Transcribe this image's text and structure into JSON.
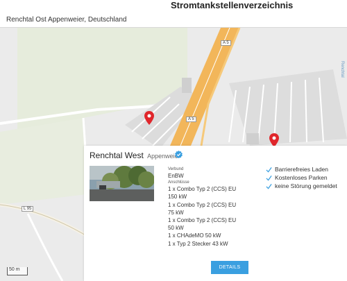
{
  "header": {
    "title": "Stromtankstellenverzeichnis",
    "location": "Renchtal Ost Appenweier, Deutschland"
  },
  "map": {
    "road_labels": [
      "A 5",
      "A 5",
      "L 95"
    ],
    "right_edge_text": "Renchtal",
    "scale": "50 m",
    "colors": {
      "background": "#ececec",
      "autobahn": "#f2b65a",
      "pin": "#e0262b"
    }
  },
  "card": {
    "name": "Renchtal West",
    "city": "Appenweier",
    "verified_icon": "verified-badge-icon",
    "operator_label": "Verbund",
    "operator": "EnBW",
    "connectors_label": "Anschlüsse",
    "connectors": [
      "1 x Combo Typ 2 (CCS) EU",
      "150 kW",
      "1 x Combo Typ 2 (CCS) EU",
      "75 kW",
      "1 x Combo Typ 2 (CCS) EU",
      "50 kW",
      "1 x CHAdeMO 50 kW",
      "1 x Typ 2 Stecker 43 kW"
    ],
    "features": [
      "Barrierefreies Laden",
      "Kostenloses Parken",
      "keine Störung gemeldet"
    ],
    "details_button": "DETAILS",
    "accent": "#3a9fe0"
  }
}
